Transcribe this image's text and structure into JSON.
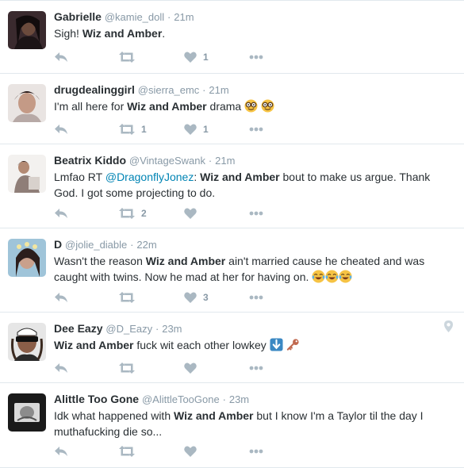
{
  "tweets": [
    {
      "name": "Gabrielle",
      "handle": "@kamie_doll",
      "sep": "·",
      "time": "21m",
      "text_parts": [
        "Sigh! ",
        "Wiz and Amber",
        "."
      ],
      "counts": {
        "reply": "",
        "retweet": "",
        "like": "1"
      }
    },
    {
      "name": "drugdealinggirl",
      "handle": "@sierra_emc",
      "sep": "·",
      "time": "21m",
      "text_parts": [
        "I'm all here for ",
        "Wiz and Amber",
        " drama "
      ],
      "emoji": [
        "nerd-face-icon",
        "nerd-face-icon"
      ],
      "counts": {
        "reply": "",
        "retweet": "1",
        "like": "1"
      }
    },
    {
      "name": "Beatrix Kiddo",
      "handle": "@VintageSwank",
      "sep": "·",
      "time": "21m",
      "text_parts": [
        "Lmfao RT ",
        "@DragonflyJonez",
        ": ",
        "Wiz and Amber",
        " bout to make us argue. Thank God. I got some projecting to do."
      ],
      "counts": {
        "reply": "",
        "retweet": "2",
        "like": ""
      }
    },
    {
      "name": "D",
      "handle": "@jolie_diable",
      "sep": "·",
      "time": "22m",
      "text_parts": [
        "Wasn't the reason ",
        "Wiz and Amber",
        " ain't married cause he cheated and was caught with twins. Now he mad at her for having on. "
      ],
      "emoji": [
        "tears-of-joy-icon",
        "tears-of-joy-icon",
        "tears-of-joy-icon"
      ],
      "counts": {
        "reply": "",
        "retweet": "",
        "like": "3"
      }
    },
    {
      "name": "Dee Eazy",
      "handle": "@D_Eazy",
      "sep": "·",
      "time": "23m",
      "text_parts": [
        "Wiz and Amber",
        " fuck wit each other lowkey "
      ],
      "emoji": [
        "down-arrow-box-icon",
        "key-icon"
      ],
      "counts": {
        "reply": "",
        "retweet": "",
        "like": ""
      }
    },
    {
      "name": "Alittle Too Gone",
      "handle": "@AlittleTooGone",
      "sep": "·",
      "time": "23m",
      "text_parts": [
        "Idk what happened with ",
        "Wiz and Amber",
        " but I know I'm a Taylor til the day I muthafucking die so..."
      ],
      "counts": {
        "reply": "",
        "retweet": "",
        "like": ""
      }
    }
  ],
  "colors": {
    "action_icon": "#aab8c2",
    "link": "#0084b4",
    "meta": "#8899a6",
    "divider": "#e1e8ed"
  }
}
